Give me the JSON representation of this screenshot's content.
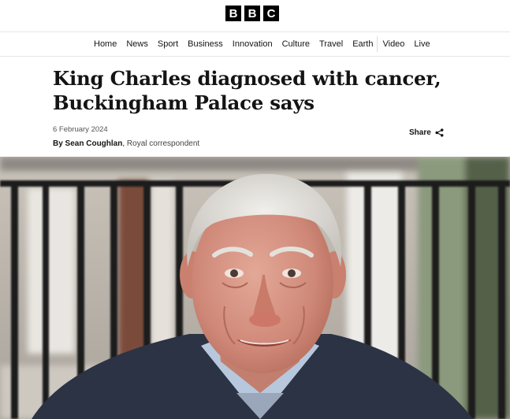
{
  "brand": {
    "letters": [
      "B",
      "B",
      "C"
    ]
  },
  "nav": {
    "items": [
      "Home",
      "News",
      "Sport",
      "Business",
      "Innovation",
      "Culture",
      "Travel",
      "Earth",
      "Video",
      "Live"
    ]
  },
  "article": {
    "headline": "King Charles diagnosed with cancer, Buckingham Palace says",
    "date": "6 February 2024",
    "author": "By Sean Coughlan",
    "role": "Royal correspondent",
    "share_label": "Share",
    "share_icon": "share-icon"
  },
  "colors": {
    "brand": "#000000",
    "text": "#141414"
  }
}
